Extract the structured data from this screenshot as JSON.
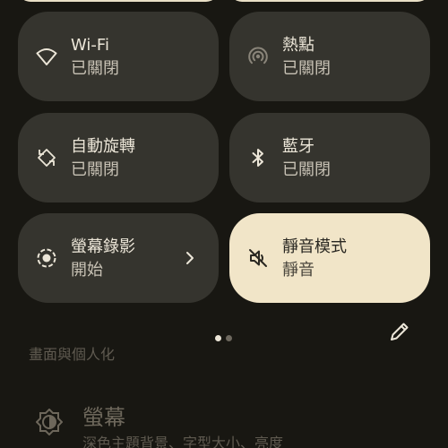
{
  "quick_settings": {
    "tiles": [
      {
        "title": "Wi-Fi",
        "subtitle": "已關閉",
        "icon": "wifi-icon",
        "active": false
      },
      {
        "title": "熱點",
        "subtitle": "已關閉",
        "icon": "hotspot-icon",
        "active": false
      },
      {
        "title": "自動旋轉",
        "subtitle": "已關閉",
        "icon": "auto-rotate-icon",
        "active": false
      },
      {
        "title": "藍牙",
        "subtitle": "已關閉",
        "icon": "bluetooth-icon",
        "active": false
      },
      {
        "title": "螢幕錄影",
        "subtitle": "開始",
        "icon": "screen-record-icon",
        "active": false,
        "has_chevron": true
      },
      {
        "title": "靜音模式",
        "subtitle": "靜音",
        "icon": "mute-icon",
        "active": true
      }
    ],
    "page_indicator": {
      "pages": 2,
      "current": 1
    },
    "edit_icon": "pencil-icon"
  },
  "settings_background": {
    "section_title": "畫面與個人化",
    "item": {
      "title": "螢幕",
      "subtitle": "深色主題背景、字型大小、亮度",
      "icon": "brightness-icon"
    }
  },
  "colors": {
    "background": "#181712",
    "tile_inactive": "#35342e",
    "tile_active": "#f1e5c8",
    "text_primary": "#ece6d8",
    "text_secondary": "#c8c2b5"
  }
}
